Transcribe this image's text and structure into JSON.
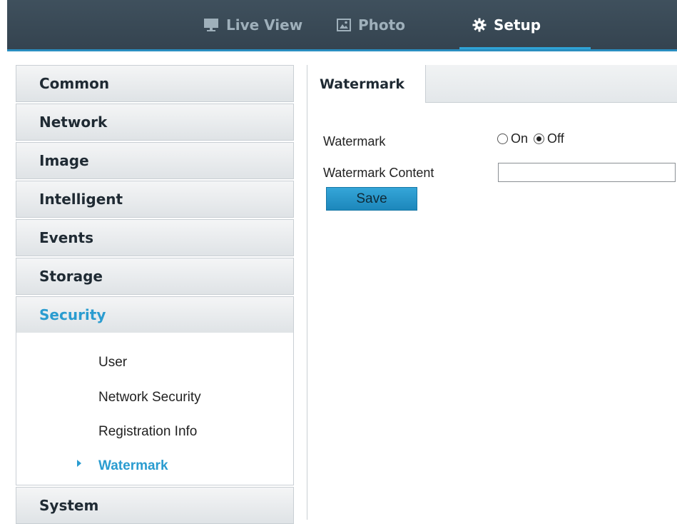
{
  "topnav": {
    "items": [
      {
        "label": "Live View",
        "icon": "monitor-icon",
        "active": false
      },
      {
        "label": "Photo",
        "icon": "image-icon",
        "active": false
      },
      {
        "label": "Setup",
        "icon": "gear-icon",
        "active": true
      }
    ]
  },
  "sidebar": {
    "items": [
      {
        "label": "Common"
      },
      {
        "label": "Network"
      },
      {
        "label": "Image"
      },
      {
        "label": "Intelligent"
      },
      {
        "label": "Events"
      },
      {
        "label": "Storage"
      },
      {
        "label": "Security",
        "active": true
      },
      {
        "label": "System"
      }
    ],
    "security_subitems": [
      {
        "label": "User"
      },
      {
        "label": "Network Security"
      },
      {
        "label": "Registration Info"
      },
      {
        "label": "Watermark",
        "active": true
      }
    ]
  },
  "content": {
    "tab_label": "Watermark",
    "watermark_label": "Watermark",
    "option_on": "On",
    "option_off": "Off",
    "selected": "Off",
    "content_label": "Watermark Content",
    "content_value": "",
    "save_label": "Save"
  },
  "colors": {
    "accent": "#2a9cd0",
    "topbar": "#3a4a56"
  }
}
